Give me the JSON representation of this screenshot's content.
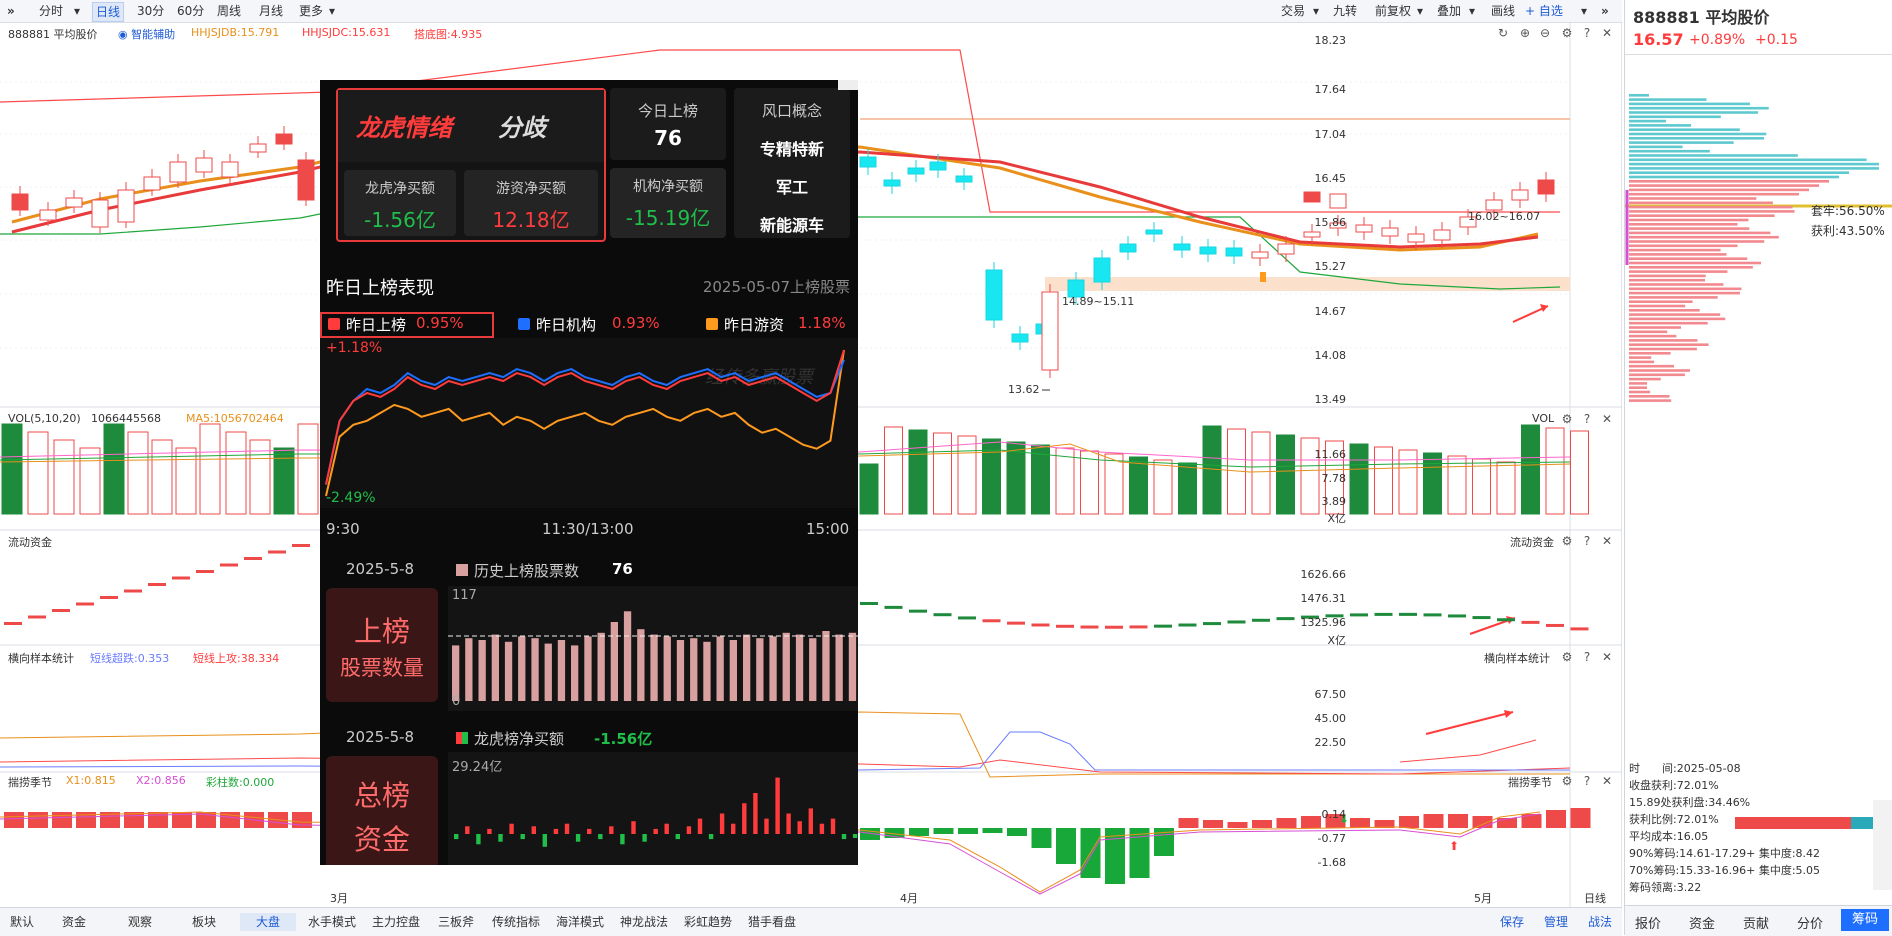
{
  "toolbar": {
    "left_items": [
      "分时",
      "日线",
      "30分",
      "60分",
      "周线",
      "月线",
      "更多"
    ],
    "active": "日线",
    "right_items": [
      "交易",
      "九转",
      "前复权",
      "叠加",
      "画线",
      "+ 自选"
    ]
  },
  "main_panel": {
    "stock_name": "888881 平均股价",
    "indicator_toggle": "智能辅助",
    "hhjsjdb": "HHJSJDB:15.791",
    "hhjsjdc": "HHJSJDC:15.631",
    "shadow": "搭底图:4.935",
    "y_ticks": [
      "18.23",
      "17.64",
      "17.04",
      "16.45",
      "15.86",
      "15.27",
      "14.67",
      "14.08",
      "13.49"
    ],
    "annotations": {
      "range_low": "14.89~15.11",
      "range_high": "16.02~16.07",
      "low": "13.62"
    }
  },
  "vol_panel": {
    "label": "VOL(5,10,20)",
    "value": "1066445568",
    "ma5": "MA5:1056702464",
    "title_right": "VOL",
    "y_ticks": [
      "11.66",
      "7.78",
      "3.89",
      "X亿"
    ]
  },
  "flow_panel": {
    "label": "流动资金",
    "title_right": "流动资金",
    "y_ticks": [
      "1626.66",
      "1476.31",
      "1325.96",
      "X亿"
    ]
  },
  "sample_panel": {
    "label": "横向样本统计",
    "short_down": "短线超跌:0.353",
    "short_up": "短线上攻:38.334",
    "title_right": "横向样本统计",
    "y_ticks": [
      "67.50",
      "45.00",
      "22.50"
    ]
  },
  "season_panel": {
    "label": "揣捞季节",
    "x1": "X1:0.815",
    "x2": "X2:0.856",
    "bars": "彩柱数:0.000",
    "title_right": "揣捞季节",
    "y_ticks": [
      "0.14",
      "-0.77",
      "-1.68"
    ]
  },
  "x_axis": {
    "m3": "3月",
    "m4": "4月",
    "m5": "5月",
    "period": "日线"
  },
  "popup": {
    "title": "龙虎情绪",
    "mood": "分歧",
    "today_label": "今日上榜",
    "today_count": "76",
    "concept_title": "风口概念",
    "concepts": [
      "专精特新",
      "军工",
      "新能源车"
    ],
    "metrics": [
      {
        "label": "龙虎净买额",
        "value": "-1.56亿"
      },
      {
        "label": "游资净买额",
        "value": "12.18亿"
      },
      {
        "label": "机构净买额",
        "value": "-15.19亿"
      }
    ],
    "perf_title": "昨日上榜表现",
    "perf_date": "2025-05-07上榜股票",
    "legend": [
      {
        "label": "昨日上榜",
        "value": "0.95%",
        "color": "#ff3b3b"
      },
      {
        "label": "昨日机构",
        "value": "0.93%",
        "color": "#1e6fff"
      },
      {
        "label": "昨日游资",
        "value": "1.18%",
        "color": "#ff9a1f"
      }
    ],
    "intraday": {
      "max_label": "+1.18%",
      "min_label": "-2.49%",
      "watermark": "经传多赢股票",
      "times": [
        "9:30",
        "11:30/13:00",
        "15:00"
      ],
      "series_red": [
        -2.2,
        -0.6,
        -0.1,
        0.1,
        0.0,
        0.2,
        0.5,
        0.3,
        0.2,
        0.4,
        0.3,
        0.4,
        0.5,
        0.4,
        0.6,
        0.5,
        0.3,
        0.5,
        0.6,
        0.4,
        0.3,
        0.2,
        0.4,
        0.5,
        0.3,
        0.2,
        0.4,
        0.5,
        0.6,
        0.4,
        0.5,
        0.3,
        0.4,
        0.5,
        0.3,
        0.1,
        -0.1,
        0.1,
        1.18
      ],
      "series_blue": [
        -2.2,
        -0.6,
        -0.1,
        0.2,
        0.1,
        0.3,
        0.6,
        0.4,
        0.3,
        0.5,
        0.4,
        0.5,
        0.6,
        0.5,
        0.7,
        0.6,
        0.4,
        0.6,
        0.7,
        0.5,
        0.4,
        0.3,
        0.5,
        0.6,
        0.4,
        0.3,
        0.5,
        0.6,
        0.7,
        0.5,
        0.6,
        0.4,
        0.5,
        0.6,
        0.4,
        0.2,
        0.0,
        0.1,
        0.93
      ],
      "series_orange": [
        -2.49,
        -1.0,
        -0.7,
        -0.6,
        -0.4,
        -0.2,
        -0.3,
        -0.5,
        -0.4,
        -0.3,
        -0.6,
        -0.5,
        -0.4,
        -0.7,
        -0.5,
        -0.6,
        -0.8,
        -0.6,
        -0.5,
        -0.4,
        -0.6,
        -0.7,
        -0.5,
        -0.4,
        -0.3,
        -0.5,
        -0.6,
        -0.4,
        -0.3,
        -0.5,
        -0.4,
        -0.7,
        -0.9,
        -0.8,
        -1.0,
        -1.2,
        -1.3,
        -1.1,
        1.18
      ]
    },
    "count_date": "2025-5-8",
    "count_legend": "历史上榜股票数",
    "count_value": "76",
    "count_max": "117",
    "count_zero": "0",
    "count_badge_line1": "上榜",
    "count_badge_line2": "股票数量",
    "count_bars": [
      62,
      70,
      68,
      74,
      66,
      72,
      70,
      64,
      68,
      62,
      72,
      76,
      88,
      100,
      80,
      74,
      72,
      68,
      70,
      66,
      72,
      68,
      74,
      70,
      72,
      76,
      74,
      70,
      78,
      74,
      76
    ],
    "money_date": "2025-5-8",
    "money_legend": "龙虎榜净买额",
    "money_value": "-1.56亿",
    "money_max": "29.24亿",
    "money_badge_line1": "总榜",
    "money_badge_line2": "资金",
    "money_bars": [
      -2,
      3,
      -4,
      2,
      -3,
      4,
      -2,
      3,
      -5,
      2,
      4,
      -3,
      2,
      -2,
      3,
      -4,
      5,
      -3,
      2,
      4,
      -2,
      3,
      6,
      -2,
      8,
      4,
      12,
      16,
      6,
      22,
      8,
      5,
      10,
      4,
      6,
      -2,
      -1.56
    ]
  },
  "right_panel": {
    "title": "888881 平均股价",
    "price": "16.57",
    "pct": "+0.89%",
    "chg": "+0.15",
    "trapped": "套牢:56.50%",
    "profit": "获利:43.50%",
    "stats": [
      "时　　间:2025-05-08",
      "收盘获利:72.01%",
      "15.89处获利盘:34.46%",
      "获利比例:72.01%",
      "平均成本:16.05",
      "90%筹码:14.61-17.29+ 集中度:8.42",
      "70%筹码:15.33-16.96+ 集中度:5.05",
      "筹码领离:3.22"
    ],
    "tabs": [
      "报价",
      "资金",
      "贡献",
      "分价",
      "筹码"
    ],
    "active_tab": "筹码"
  },
  "bottom_bar": {
    "items": [
      "默认",
      "资金",
      "观察",
      "板块",
      "大盘",
      "水手模式",
      "主力控盘",
      "三板斧",
      "传统指标",
      "海洋模式",
      "神龙战法",
      "彩虹趋势",
      "猎手看盘"
    ],
    "active": "大盘",
    "right_items": [
      "保存",
      "管理",
      "战法"
    ]
  }
}
